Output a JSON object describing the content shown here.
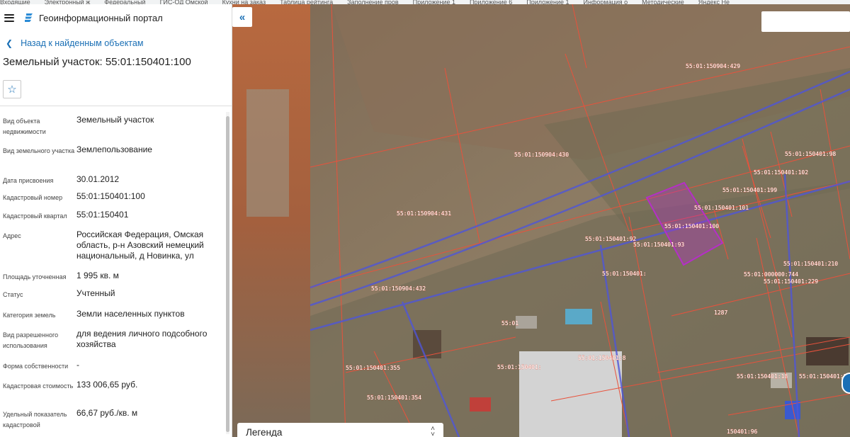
{
  "bookmarks": [
    "Входящие",
    "Электронный ж",
    "Федеральный",
    "ГИС-ОД Омской",
    "Кухни на заказ",
    "Таблица рейтинга",
    "Заполнение пров",
    "Приложение 1",
    "Приложение 6",
    "Приложение 1",
    "Информация о",
    "Методические",
    "Яндекс Не"
  ],
  "header": {
    "portal_title": "Геоинформационный портал"
  },
  "nav": {
    "back_label": "Назад к найденным объектам"
  },
  "object": {
    "title": "Земельный участок: 55:01:150401:100"
  },
  "properties": [
    {
      "label": "Вид объекта недвижимости",
      "value": "Земельный участок"
    },
    {
      "label": "Вид земельного участка",
      "value": "Землепользование"
    },
    {
      "label": "Дата присвоения",
      "value": "30.01.2012"
    },
    {
      "label": "Кадастровый номер",
      "value": "55:01:150401:100"
    },
    {
      "label": "Кадастровый квартал",
      "value": "55:01:150401"
    },
    {
      "label": "Адрес",
      "value": "Российская Федерация, Омская область, р-н Азовский немецкий национальный, д Новинка, ул"
    },
    {
      "label": "Площадь уточненная",
      "value": "1 995 кв. м"
    },
    {
      "label": "Статус",
      "value": "Учтенный"
    },
    {
      "label": "Категория земель",
      "value": "Земли населенных пунктов"
    },
    {
      "label": "Вид разрешенного использования",
      "value": "для ведения личного подсобного хозяйства"
    },
    {
      "label": "Форма собственности",
      "value": "-"
    },
    {
      "label": "Кадастровая стоимость",
      "value": "133 006,65 руб."
    },
    {
      "label": "Удельный показатель кадастровой",
      "value": "66,67 руб./кв. м"
    }
  ],
  "map": {
    "legend_label": "Легенда",
    "parcel_labels": [
      "55:01:150904:429",
      "55:01:150904:430",
      "55:01:150401:98",
      "55:01:150401:102",
      "55:01:150401:199",
      "55:01:150401:101",
      "55:01:150904:431",
      "55:01:150401:100",
      "55:01:150401:92",
      "55:01:150401:93",
      "55:01:150401:210",
      "55:01:000000:744",
      "55:01:150401:229",
      "55:01:150904:432",
      "55:01:150401:8",
      "55:01:150401:355",
      "55:01:150401:354",
      "55:01:150401:18",
      "55:01:150401:97",
      "150401:96",
      "55:01",
      "55:01:150401:",
      "55:01:150401:",
      "1287"
    ],
    "colors": {
      "parcel_border": "#e8523c",
      "selected_parcel": "#b52fc7",
      "boundary": "#4f56d8",
      "accent": "#1a6fb5"
    }
  }
}
